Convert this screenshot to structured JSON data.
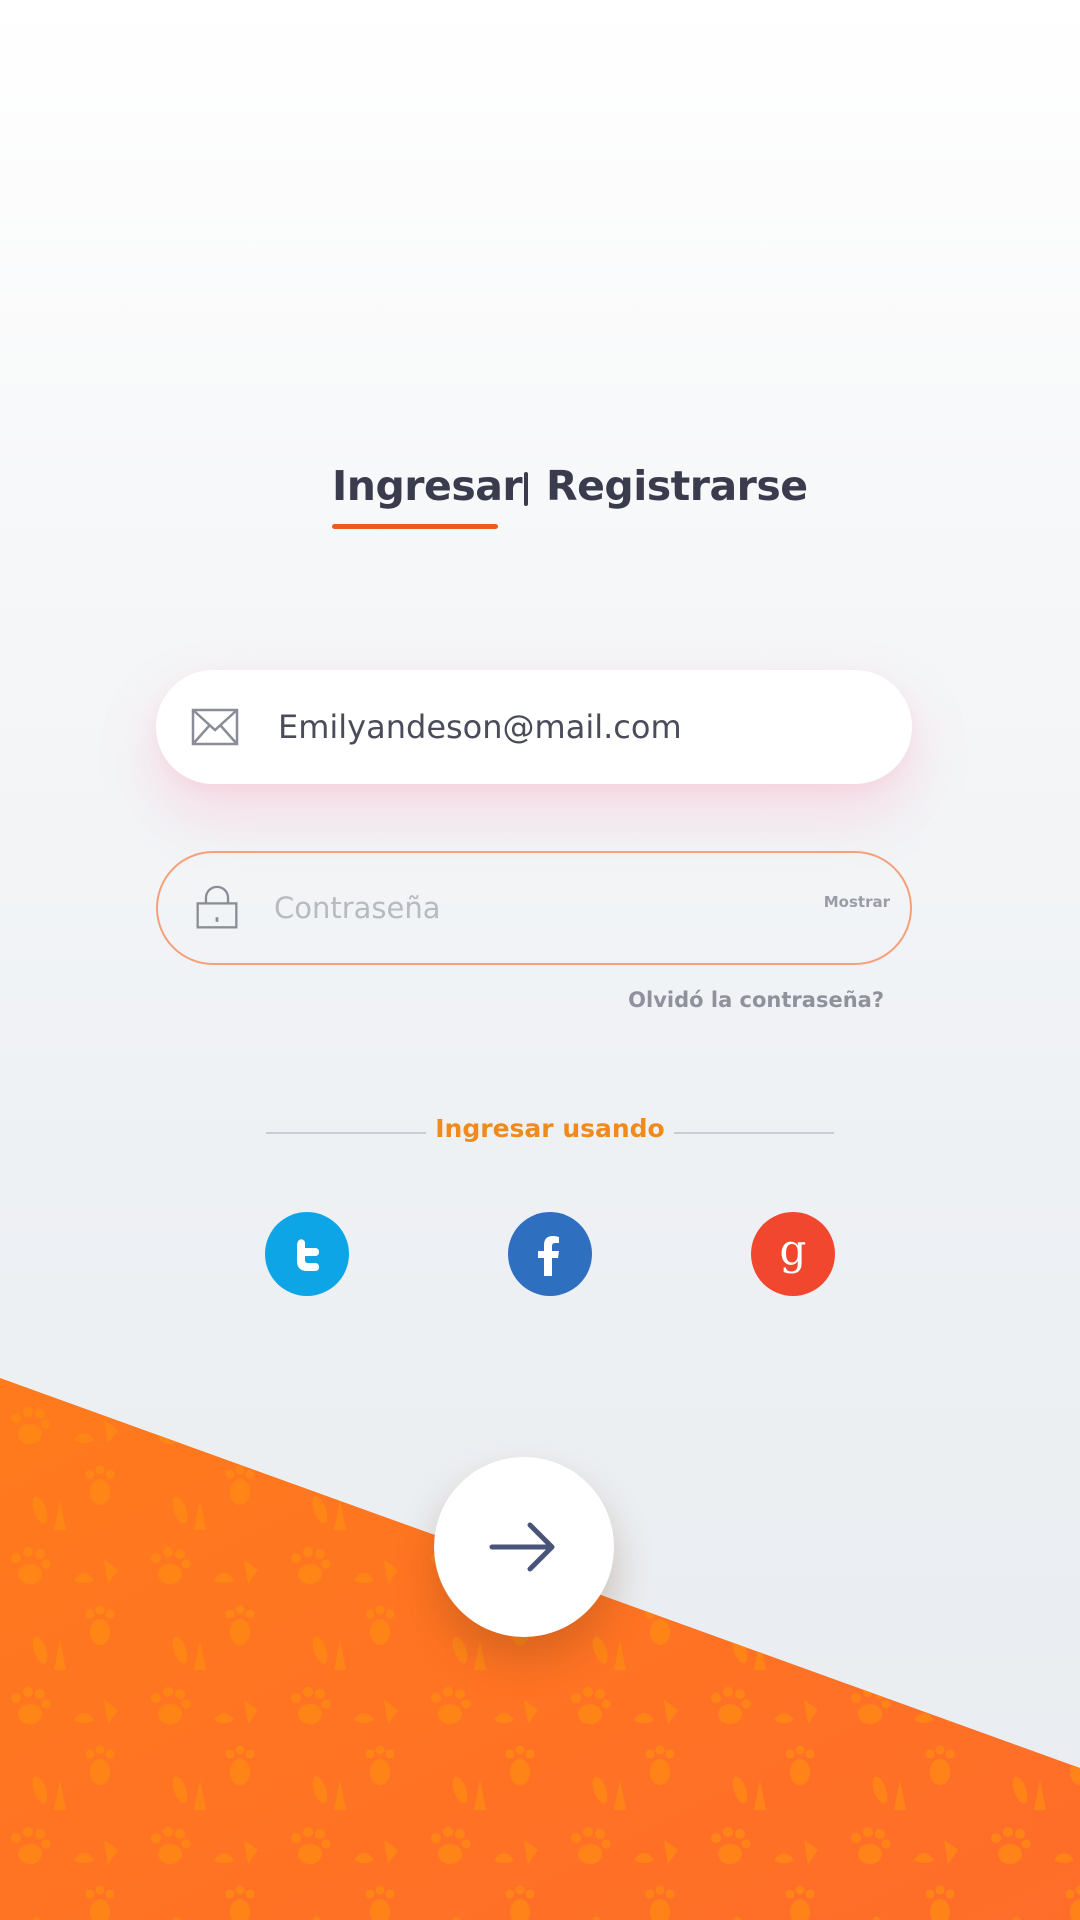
{
  "tabs": {
    "login_label": "Ingresar",
    "register_label": "Registrarse",
    "active": "login"
  },
  "email_field": {
    "icon": "envelope-icon",
    "value": "Emilyandeson@mail.com"
  },
  "password_field": {
    "icon": "lock-icon",
    "placeholder": "Contraseña",
    "show_label": "Mostrar"
  },
  "forgot_password_label": "Olvidó la contraseña?",
  "social": {
    "heading": "Ingresar usando",
    "providers": [
      {
        "name": "twitter",
        "icon": "twitter-icon",
        "color": "#0ea5e6"
      },
      {
        "name": "facebook",
        "icon": "facebook-icon",
        "color": "#2f6fbf"
      },
      {
        "name": "google",
        "icon": "google-icon",
        "color": "#f2472f"
      }
    ]
  },
  "submit": {
    "icon": "arrow-right-icon"
  },
  "colors": {
    "accent_orange": "#ff7a1f",
    "tab_underline": "#ef5a1e",
    "text_dark": "#3a3c4e",
    "social_heading": "#f08a1c",
    "arrow": "#4a5478"
  }
}
